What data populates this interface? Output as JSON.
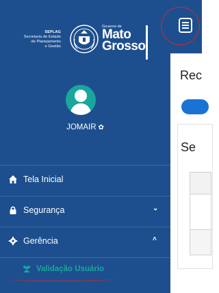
{
  "brand": {
    "left_lines": [
      "SEPLAG",
      "Secretaria de Estado",
      "de Planejamento",
      "e Gestão"
    ],
    "gov_label": "Governo de",
    "state_line1": "Mato",
    "state_line2": "Grosso"
  },
  "user": {
    "name": "JOMAIR",
    "gear_glyph": "✿"
  },
  "menu": [
    {
      "label": "Tela Inicial",
      "icon": "home-icon"
    },
    {
      "label": "Segurança",
      "icon": "lock-icon",
      "chevron": "⌄"
    },
    {
      "label": "Gerência",
      "icon": "gear-icon",
      "chevron": "˄"
    }
  ],
  "submenu": {
    "label": "Validação Usuário",
    "icon": "users-icon",
    "color": "#1aa69c"
  },
  "content": {
    "partial_heading_1": "Rec",
    "partial_heading_2": "Se"
  },
  "colors": {
    "sidebar": "#1d4f8e",
    "accent": "#1aa69c",
    "annotation": "#d7262e",
    "button": "#1a73d4"
  }
}
